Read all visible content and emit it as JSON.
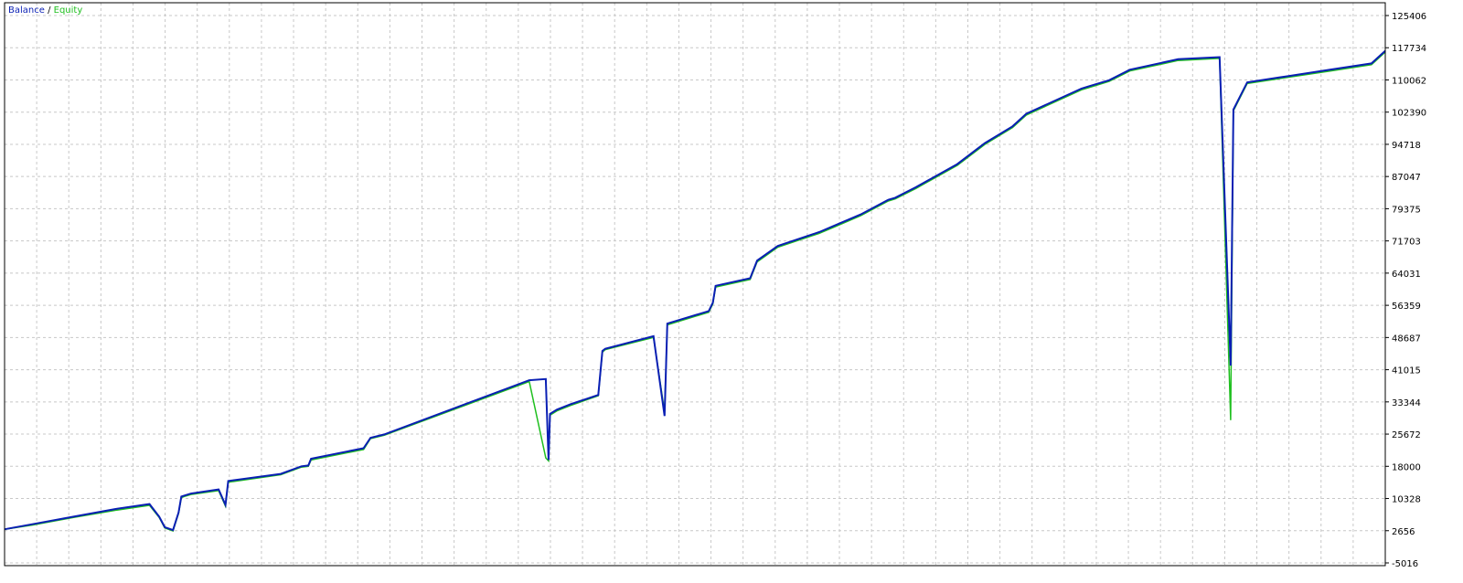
{
  "legend": {
    "balance_label": "Balance",
    "separator": " / ",
    "equity_label": "Equity"
  },
  "colors": {
    "balance": "#0a1fb4",
    "equity": "#1fbf1f",
    "grid": "#c8c8c8",
    "frame": "#000000",
    "text": "#000000"
  },
  "chart_data": {
    "type": "line",
    "title": "",
    "xlabel": "",
    "ylabel": "",
    "ylim": [
      -5016,
      125406
    ],
    "y_ticks": [
      "125406",
      "117734",
      "110062",
      "102390",
      "94718",
      "87047",
      "79375",
      "71703",
      "64031",
      "56359",
      "48687",
      "41015",
      "33344",
      "25672",
      "18000",
      "10328",
      "2656",
      "-5016"
    ],
    "y_tick_values": [
      125406,
      117734,
      110062,
      102390,
      94718,
      87047,
      79375,
      71703,
      64031,
      56359,
      48687,
      41015,
      33344,
      25672,
      18000,
      10328,
      2656,
      -5016
    ],
    "x_range": [
      0,
      1000
    ],
    "grid": true,
    "legend_position": "top-left",
    "series": [
      {
        "name": "Balance",
        "x": [
          0,
          20,
          50,
          80,
          105,
          112,
          116,
          122,
          126,
          128,
          130,
          135,
          155,
          160,
          162,
          200,
          215,
          220,
          222,
          260,
          265,
          275,
          380,
          392,
          394,
          395,
          400,
          410,
          430,
          433,
          435,
          470,
          478,
          480,
          510,
          513,
          515,
          540,
          545,
          560,
          590,
          600,
          620,
          640,
          645,
          660,
          690,
          710,
          730,
          740,
          780,
          785,
          800,
          815,
          850,
          880,
          888,
          890,
          900,
          930,
          960,
          990,
          1000
        ],
        "y": [
          3000,
          4200,
          6000,
          7800,
          9000,
          6000,
          3500,
          2800,
          7000,
          10800,
          11000,
          11500,
          12500,
          8800,
          14500,
          16200,
          18000,
          18200,
          19800,
          22300,
          24800,
          25600,
          38500,
          38800,
          19500,
          30500,
          31500,
          32800,
          35000,
          45500,
          46000,
          49000,
          30000,
          52000,
          55000,
          57000,
          61000,
          62800,
          67000,
          70500,
          73800,
          75200,
          78000,
          81500,
          82000,
          84500,
          90000,
          95000,
          99000,
          102000,
          108000,
          108500,
          110000,
          112500,
          115000,
          115500,
          42000,
          103000,
          109500,
          111000,
          112500,
          114000,
          117000
        ]
      },
      {
        "name": "Equity",
        "x": [
          0,
          20,
          50,
          80,
          105,
          112,
          116,
          122,
          126,
          128,
          130,
          135,
          155,
          160,
          162,
          200,
          215,
          220,
          222,
          260,
          265,
          275,
          380,
          392,
          394,
          395,
          400,
          410,
          430,
          433,
          435,
          470,
          478,
          480,
          510,
          513,
          515,
          540,
          545,
          560,
          590,
          600,
          620,
          640,
          645,
          660,
          690,
          710,
          730,
          740,
          780,
          785,
          800,
          815,
          850,
          880,
          888,
          890,
          900,
          930,
          960,
          990,
          1000
        ],
        "y": [
          3000,
          4000,
          5800,
          7500,
          8700,
          5800,
          3300,
          2600,
          6800,
          10500,
          10800,
          11300,
          12200,
          8500,
          14200,
          16000,
          17800,
          18000,
          19500,
          22000,
          24600,
          25400,
          38200,
          20000,
          19300,
          30200,
          31200,
          32500,
          34800,
          45200,
          45800,
          48700,
          31000,
          51700,
          54700,
          56700,
          60700,
          62500,
          66700,
          70200,
          73500,
          74900,
          77700,
          81200,
          81700,
          84200,
          89700,
          94700,
          98700,
          101700,
          107700,
          108200,
          109700,
          112200,
          114700,
          115200,
          29000,
          102700,
          109200,
          110700,
          112200,
          113700,
          116700
        ]
      }
    ]
  }
}
